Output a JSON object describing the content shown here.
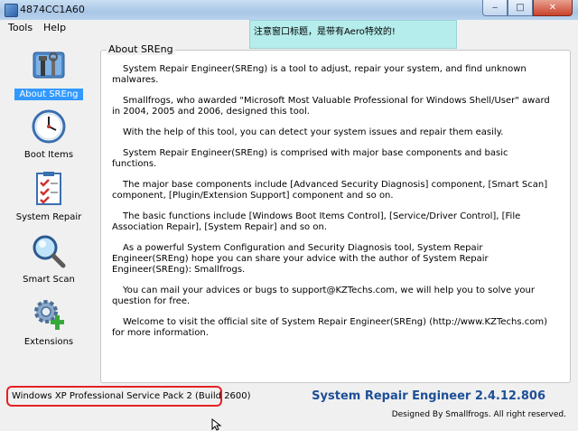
{
  "window": {
    "title": "4874CC1A60"
  },
  "caption_buttons": {
    "minimize": "‒",
    "maximize": "□",
    "close": "✕"
  },
  "menu": {
    "items": [
      "Tools",
      "Help"
    ]
  },
  "aero_note": "注意窗口标题，是带有Aero特效的!",
  "sidebar": {
    "items": [
      {
        "label": "About SREng",
        "icon": "tools-icon",
        "active": true
      },
      {
        "label": "Boot Items",
        "icon": "clock-icon",
        "active": false
      },
      {
        "label": "System Repair",
        "icon": "checklist-icon",
        "active": false
      },
      {
        "label": "Smart Scan",
        "icon": "magnifier-icon",
        "active": false
      },
      {
        "label": "Extensions",
        "icon": "gear-plus-icon",
        "active": false
      }
    ]
  },
  "about": {
    "title": "About SREng",
    "paragraphs": [
      "System Repair Engineer(SREng) is a tool to adjust, repair your system, and find unknown malwares.",
      "Smallfrogs, who awarded \"Microsoft Most Valuable Professional for Windows Shell/User\" award in 2004, 2005 and 2006, designed this tool.",
      "With the help of this tool, you can detect your system issues and repair them easily.",
      "System Repair Engineer(SREng) is comprised with major base components and basic functions.",
      "The major base components include [Advanced Security Diagnosis] component, [Smart Scan] component, [Plugin/Extension Support] component and so on.",
      "The basic functions include [Windows Boot Items Control], [Service/Driver Control], [File Association Repair], [System Repair] and so on.",
      "As a powerful System Configuration and Security Diagnosis tool, System Repair Engineer(SREng) hope you can share your advice with the author of System Repair Engineer(SREng): Smallfrogs.",
      "You can mail your advices or bugs to support@KZTechs.com, we will help you to solve your question for free.",
      "Welcome to visit the official site of System Repair Engineer(SREng) (http://www.KZTechs.com) for more information."
    ]
  },
  "status": {
    "os": "Windows XP Professional Service Pack 2 (Build 2600)",
    "product": "System Repair Engineer 2.4.12.806",
    "designer": "Designed By Smallfrogs. All right reserved."
  },
  "colors": {
    "accent": "#3399ff",
    "product": "#1d4f96",
    "highlight": "#e52222",
    "note_bg": "#b5ecec"
  }
}
